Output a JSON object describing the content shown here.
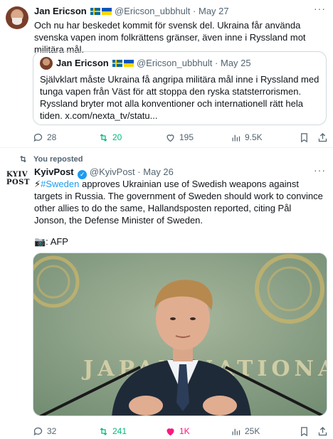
{
  "tweet1": {
    "author_name": "Jan Ericson",
    "handle": "@Ericson_ubbhult",
    "date": "May 27",
    "text": "Och nu har beskedet kommit för svensk del. Ukraina får använda svenska vapen inom folkrättens gränser, även inne i Ryssland mot militära mål.",
    "quote": {
      "author_name": "Jan Ericson",
      "handle": "@Ericson_ubbhult",
      "date": "May 25",
      "text": "Självklart måste Ukraina få angripa militära mål inne  i Ryssland med tunga vapen från Väst för att stoppa den ryska statsterrorismen. Ryssland bryter mot alla konventioner och internationell rätt hela tiden. x.com/nexta_tv/statu..."
    },
    "stats": {
      "replies": "28",
      "reposts": "20",
      "likes": "195",
      "views": "9.5K"
    }
  },
  "tweet2": {
    "repost_label": "You reposted",
    "logo_text_1": "KYIV",
    "logo_text_2": "POST",
    "author_name": "KyivPost",
    "handle": "@KyivPost",
    "date": "May 26",
    "emoji": "⚡",
    "hashtag": "#Sweden",
    "text": " approves Ukrainian use of Swedish weapons against targets in Russia. The government of Sweden should work to convince other allies to do the same, Hallandsposten reported, citing Pål Jonson, the Defense Minister of Sweden.",
    "credit": "📷: AFP",
    "photo_text": "JAPAN NATIONAL",
    "stats": {
      "replies": "32",
      "reposts": "241",
      "likes": "1K",
      "views": "25K"
    }
  },
  "colors": {
    "accent": "#1d9bf0",
    "repost_active": "#00ba7c",
    "like_active": "#f91880",
    "muted": "#536471"
  },
  "icons": [
    "reply-icon",
    "repost-icon",
    "like-icon",
    "views-icon",
    "bookmark-icon",
    "share-icon",
    "more-icon",
    "verified-icon",
    "camera-emoji"
  ]
}
